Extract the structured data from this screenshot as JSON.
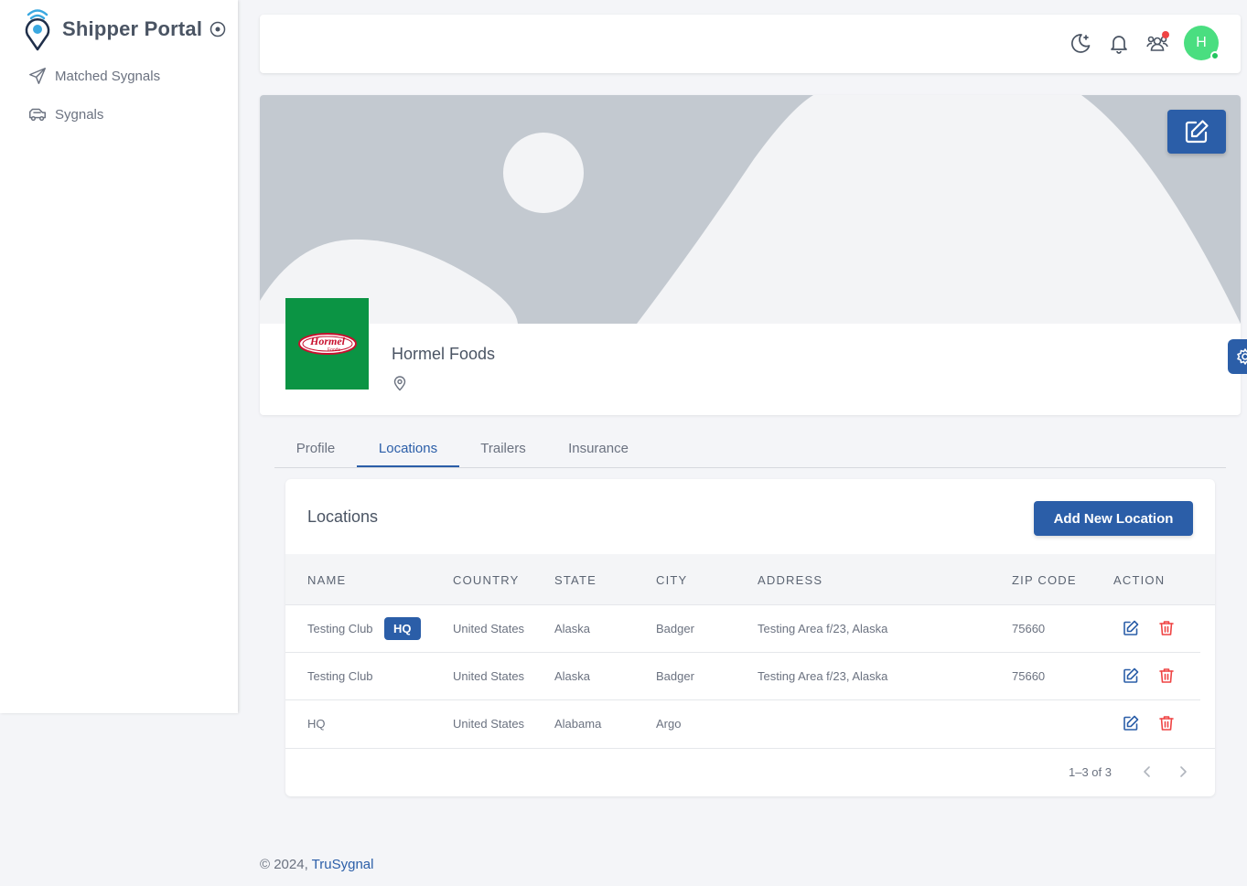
{
  "app": {
    "title": "Shipper Portal"
  },
  "sidebar": {
    "items": [
      {
        "label": "Matched Sygnals",
        "icon": "send-icon"
      },
      {
        "label": "Sygnals",
        "icon": "truck-icon"
      }
    ]
  },
  "topbar": {
    "avatar_initial": "H"
  },
  "profile": {
    "company_name": "Hormel Foods",
    "logo_text": "Hormel",
    "logo_subtext": "Foods"
  },
  "tabs": [
    {
      "label": "Profile",
      "active": false
    },
    {
      "label": "Locations",
      "active": true
    },
    {
      "label": "Trailers",
      "active": false
    },
    {
      "label": "Insurance",
      "active": false
    }
  ],
  "locations": {
    "title": "Locations",
    "add_button": "Add New Location",
    "columns": [
      "NAME",
      "COUNTRY",
      "STATE",
      "CITY",
      "ADDRESS",
      "ZIP CODE",
      "ACTION"
    ],
    "rows": [
      {
        "name": "Testing Club",
        "badge": "HQ",
        "country": "United States",
        "state": "Alaska",
        "city": "Badger",
        "address": "Testing Area f/23, Alaska",
        "zip": "75660"
      },
      {
        "name": "Testing Club",
        "badge": "",
        "country": "United States",
        "state": "Alaska",
        "city": "Badger",
        "address": "Testing Area f/23, Alaska",
        "zip": "75660"
      },
      {
        "name": "HQ",
        "badge": "",
        "country": "United States",
        "state": "Alabama",
        "city": "Argo",
        "address": "",
        "zip": ""
      }
    ],
    "pagination": "1–3 of 3"
  },
  "footer": {
    "copyright": "© 2024,",
    "brand_link": "TruSygnal"
  },
  "colors": {
    "primary": "#2b5ea8",
    "avatar": "#4ade80",
    "online": "#22c55e",
    "danger": "#ef4444",
    "logo_bg": "#0b9444",
    "cover": "#c3c9d0"
  }
}
